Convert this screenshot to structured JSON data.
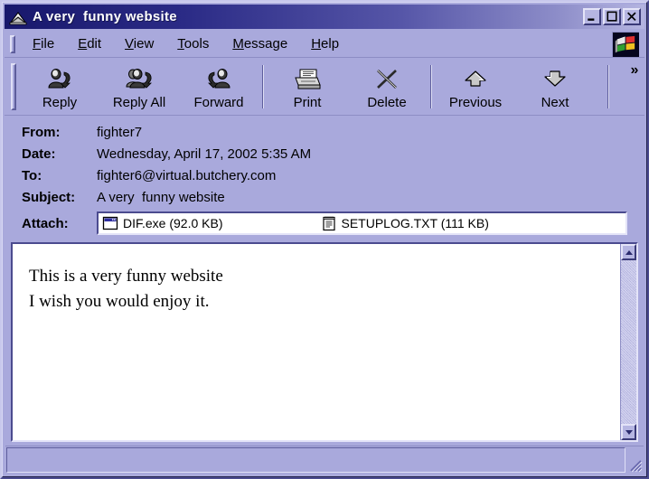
{
  "window": {
    "title": "A very  funny website",
    "icon": "envelope-icon",
    "controls": [
      {
        "name": "minimize-button",
        "glyph": "_",
        "label": "Minimize"
      },
      {
        "name": "maximize-button",
        "glyph": "□",
        "label": "Maximize"
      },
      {
        "name": "close-button",
        "glyph": "X",
        "label": "Close"
      }
    ]
  },
  "menubar": {
    "items": [
      {
        "label": "File",
        "accel": "F"
      },
      {
        "label": "Edit",
        "accel": "E"
      },
      {
        "label": "View",
        "accel": "V"
      },
      {
        "label": "Tools",
        "accel": "T"
      },
      {
        "label": "Message",
        "accel": "M"
      },
      {
        "label": "Help",
        "accel": "H"
      }
    ],
    "logo_icon": "windows-flag-icon"
  },
  "toolbar": {
    "buttons": [
      {
        "label": "Reply",
        "icon": "reply-icon"
      },
      {
        "label": "Reply All",
        "icon": "reply-all-icon"
      },
      {
        "label": "Forward",
        "icon": "forward-icon"
      },
      {
        "label": "Print",
        "icon": "printer-icon"
      },
      {
        "label": "Delete",
        "icon": "delete-x-icon"
      },
      {
        "label": "Previous",
        "icon": "up-arrow-icon"
      },
      {
        "label": "Next",
        "icon": "down-arrow-icon"
      }
    ],
    "overflow_label": "»"
  },
  "headers": {
    "from_label": "From:",
    "from_value": "fighter7",
    "date_label": "Date:",
    "date_value": "Wednesday, April 17, 2002 5:35 AM",
    "to_label": "To:",
    "to_value": "fighter6@virtual.butchery.com",
    "subject_label": "Subject:",
    "subject_value": "A very  funny website",
    "attach_label": "Attach:"
  },
  "attachments": [
    {
      "name": "DIF.exe",
      "size": "92.0 KB",
      "display": "DIF.exe (92.0 KB)",
      "icon": "application-window-icon"
    },
    {
      "name": "SETUPLOG.TXT",
      "size": "111 KB",
      "display": "SETUPLOG.TXT (111 KB)",
      "icon": "notepad-text-icon"
    }
  ],
  "body": {
    "text": "This is a very funny website\nI wish you would enjoy it.",
    "line1": "This is a very funny website",
    "line2": "I wish you would enjoy it."
  },
  "scrollbar": {
    "up_label": "▲",
    "down_label": "▼"
  },
  "statusbar": {
    "text": ""
  },
  "colors": {
    "window_background": "#a9a9dc",
    "titlebar_start": "#18186c",
    "titlebar_end": "#b4b4e0",
    "title_text": "#ffffff",
    "field_background": "#ffffff",
    "body_text": "#000000",
    "shadow": "#4b4b8f",
    "highlight": "#e4e4f8"
  }
}
